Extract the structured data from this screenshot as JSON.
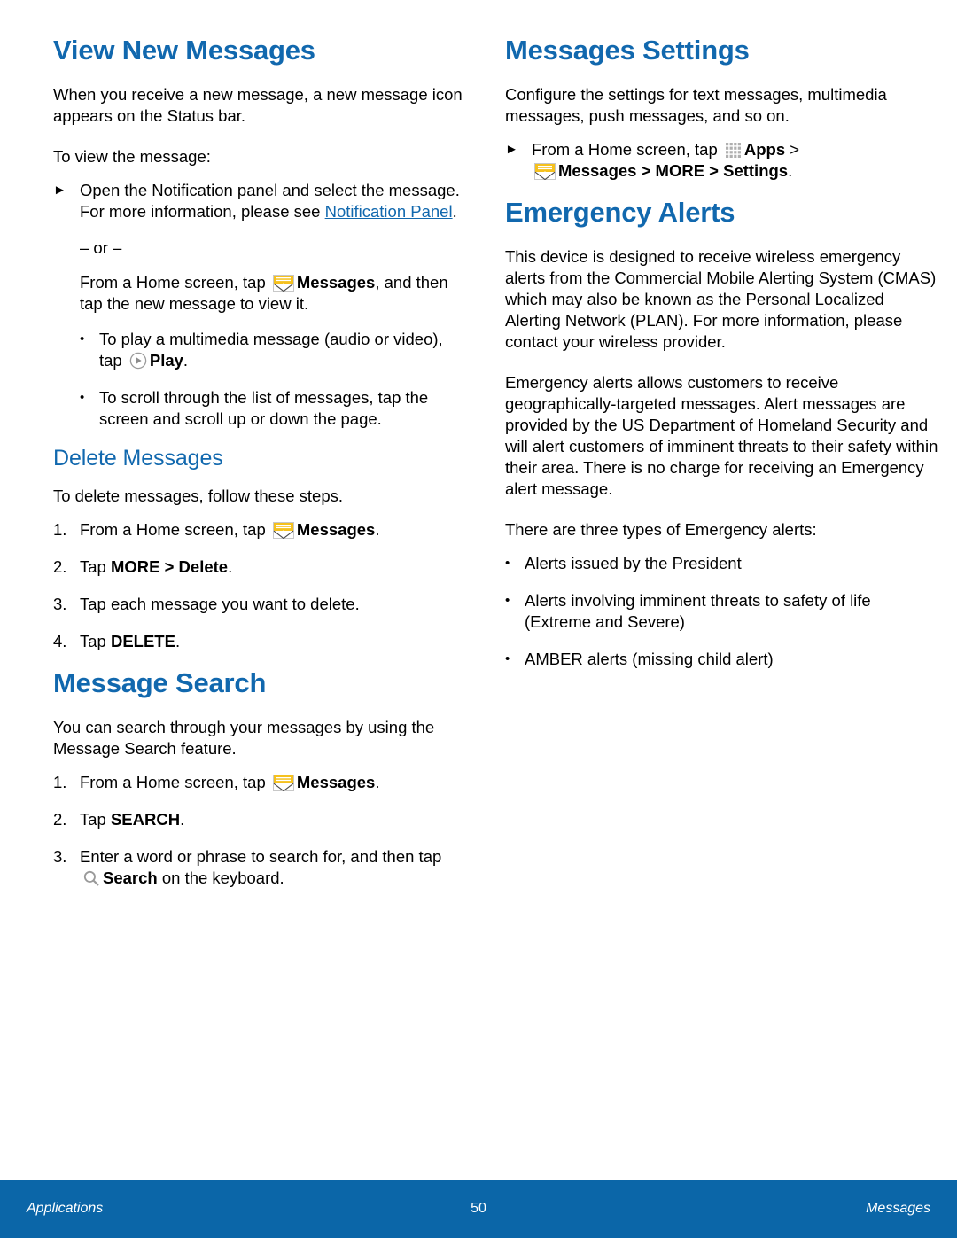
{
  "colors": {
    "heading_blue": "#1168ae",
    "footer_blue": "#0b66a8",
    "link_blue": "#1168ae",
    "envelope_yellow": "#f5c11e",
    "icon_gray": "#9a9a9a"
  },
  "left_column": {
    "section1": {
      "title": "View New Messages",
      "intro": "When you receive a new message, a new message icon appears on the Status bar.",
      "lead_in": "To view the message:",
      "step_arrow": {
        "marker": "►",
        "text_before_link": "Open the Notification panel and select the message. For more information, please see ",
        "link_text": "Notification Panel",
        "text_after_link": "."
      },
      "or_divider": "– or –",
      "alt_instruction": {
        "pre": "From a Home screen, tap ",
        "icon": "messages-envelope-icon",
        "bold": "Messages",
        "post": ", and then tap the new message to view it."
      },
      "bullets": [
        {
          "marker": "•",
          "pre": "To play a multimedia message (audio or video), tap ",
          "icon": "play-icon",
          "bold": "Play",
          "post": "."
        },
        {
          "marker": "•",
          "pre": "To scroll through the list of messages, tap the screen and scroll up or down the page.",
          "icon": "",
          "bold": "",
          "post": ""
        }
      ]
    },
    "section2": {
      "title": "Delete Messages",
      "intro": "To delete messages, follow these steps.",
      "steps": [
        {
          "num": "1.",
          "pre": "From a Home screen, tap ",
          "icon": "messages-envelope-icon",
          "bold": "Messages",
          "post": "."
        },
        {
          "num": "2.",
          "pre": "Tap ",
          "icon": "",
          "bold": "MORE > Delete",
          "post": "."
        },
        {
          "num": "3.",
          "pre": "Tap each message you want to delete.",
          "icon": "",
          "bold": "",
          "post": ""
        },
        {
          "num": "4.",
          "pre": "Tap ",
          "icon": "",
          "bold": "DELETE",
          "post": "."
        }
      ]
    },
    "section3": {
      "title": "Message Search",
      "intro": "You can search through your messages by using the Message Search feature.",
      "steps": [
        {
          "num": "1.",
          "pre": "From a Home screen, tap ",
          "icon": "messages-envelope-icon",
          "bold": "Messages",
          "post": "."
        },
        {
          "num": "2.",
          "pre": "Tap ",
          "icon": "",
          "bold": "SEARCH",
          "post": "."
        },
        {
          "num": "3.",
          "pre": "Enter a word or phrase to search for, and then tap ",
          "icon": "search-icon",
          "bold": "Search",
          "post": " on the keyboard."
        }
      ]
    }
  },
  "right_column": {
    "section1": {
      "title": "Messages Settings",
      "intro": "Configure the settings for text messages, multimedia messages, push messages, and so on.",
      "step_arrow": {
        "marker": "►",
        "pre": "From a Home screen, tap ",
        "apps_icon": "apps-grid-icon",
        "apps_bold": "Apps",
        "mid": " > ",
        "messages_icon": "messages-envelope-icon",
        "messages_bold": "Messages > MORE > Settings",
        "post": "."
      }
    },
    "section2": {
      "title": "Emergency Alerts",
      "paragraph1": "This device is designed to receive wireless emergency alerts from the Commercial Mobile Alerting System (CMAS) which may also be known as the Personal Localized Alerting Network (PLAN). For more information, please contact your wireless provider.",
      "paragraph2": "Emergency alerts allows customers to receive geographically-targeted messages. Alert messages are provided by the US Department of Homeland Security and will alert customers of imminent threats to their safety within their area. There is no charge for receiving an Emergency alert message.",
      "paragraph3": "There are three types of Emergency alerts:",
      "bullets": [
        {
          "marker": "•",
          "text": "Alerts issued by the President"
        },
        {
          "marker": "•",
          "text": "Alerts involving imminent threats to safety of life (Extreme and Severe)"
        },
        {
          "marker": "•",
          "text": "AMBER alerts (missing child alert)"
        }
      ]
    }
  },
  "footer": {
    "left": "Applications",
    "page_number": "50",
    "right": "Messages"
  }
}
